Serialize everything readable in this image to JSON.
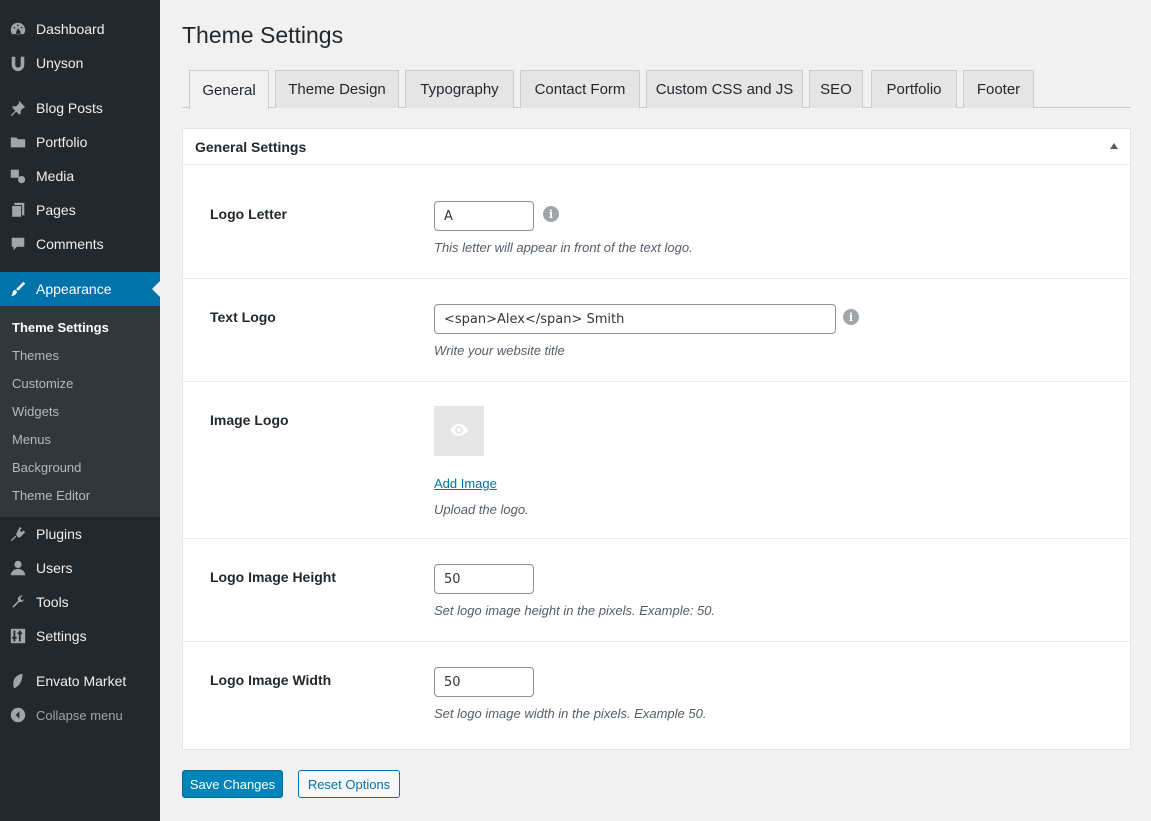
{
  "sidebar": {
    "items": [
      {
        "label": "Dashboard",
        "icon": "dashboard-icon"
      },
      {
        "label": "Unyson",
        "icon": "unyson-icon"
      },
      {
        "label": "Blog Posts",
        "icon": "pin-icon"
      },
      {
        "label": "Portfolio",
        "icon": "folder-icon"
      },
      {
        "label": "Media",
        "icon": "media-icon"
      },
      {
        "label": "Pages",
        "icon": "pages-icon"
      },
      {
        "label": "Comments",
        "icon": "comment-icon"
      },
      {
        "label": "Appearance",
        "icon": "brush-icon"
      },
      {
        "label": "Plugins",
        "icon": "plugin-icon"
      },
      {
        "label": "Users",
        "icon": "user-icon"
      },
      {
        "label": "Tools",
        "icon": "wrench-icon"
      },
      {
        "label": "Settings",
        "icon": "sliders-icon"
      },
      {
        "label": "Envato Market",
        "icon": "leaf-icon"
      },
      {
        "label": "Collapse menu",
        "icon": "collapse-icon"
      }
    ],
    "submenu": [
      "Theme Settings",
      "Themes",
      "Customize",
      "Widgets",
      "Menus",
      "Background",
      "Theme Editor"
    ]
  },
  "page": {
    "title": "Theme Settings"
  },
  "tabs": [
    "General",
    "Theme Design",
    "Typography",
    "Contact Form",
    "Custom CSS and JS",
    "SEO",
    "Portfolio",
    "Footer"
  ],
  "panel": {
    "title": "General Settings",
    "fields": {
      "logo_letter": {
        "label": "Logo Letter",
        "value": "A",
        "description": "This letter will appear in front of the text logo."
      },
      "text_logo": {
        "label": "Text Logo",
        "value": "<span>Alex</span> Smith",
        "description": "Write your website title"
      },
      "image_logo": {
        "label": "Image Logo",
        "link": "Add Image",
        "description": "Upload the logo."
      },
      "logo_height": {
        "label": "Logo Image Height",
        "value": "50",
        "description": "Set logo image height in the pixels. Example: 50."
      },
      "logo_width": {
        "label": "Logo Image Width",
        "value": "50",
        "description": "Set logo image width in the pixels. Example 50."
      }
    }
  },
  "buttons": {
    "save": "Save Changes",
    "reset": "Reset Options"
  },
  "colors": {
    "sidebar_bg": "#23282d",
    "submenu_bg": "#32373c",
    "accent": "#0073aa",
    "primary_button": "#0085ba"
  }
}
